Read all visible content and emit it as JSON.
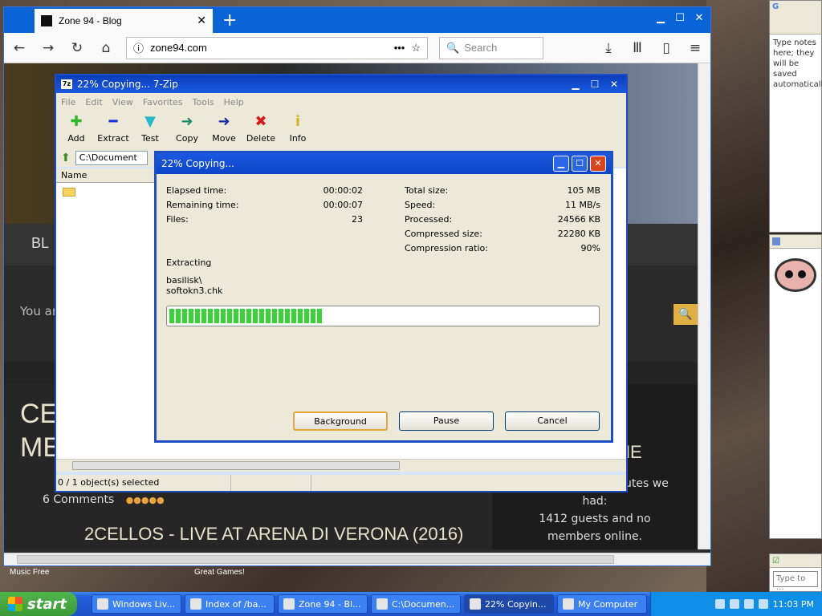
{
  "firefox": {
    "tab_title": "Zone 94 - Blog",
    "url": "zone94.com",
    "search_placeholder": "Search",
    "blog": {
      "nav_text": "BL",
      "breadcrumb": "You ar",
      "big_title": "CEL MET",
      "comments": "6 Comments",
      "post_title": "2CELLOS - LIVE AT ARENA DI VERONA (2016)",
      "side_heading": "INE",
      "side_minutes": "nutes we",
      "side_had": "had:",
      "side_guests": "1412 guests and no",
      "side_members": "members online."
    }
  },
  "zip": {
    "title": "22% Copying... 7-Zip",
    "menu": [
      "File",
      "Edit",
      "View",
      "Favorites",
      "Tools",
      "Help"
    ],
    "tools": [
      {
        "label": "Add",
        "glyph": "✚",
        "color": "#2fb82f",
        "name": "add"
      },
      {
        "label": "Extract",
        "glyph": "━",
        "color": "#1a2fd0",
        "name": "extract"
      },
      {
        "label": "Test",
        "glyph": "▼",
        "color": "#28b8c8",
        "name": "test"
      },
      {
        "label": "Copy",
        "glyph": "➜",
        "color": "#1c8c6c",
        "name": "copy"
      },
      {
        "label": "Move",
        "glyph": "➜",
        "color": "#1a2a9c",
        "name": "move"
      },
      {
        "label": "Delete",
        "glyph": "✖",
        "color": "#d41a1a",
        "name": "delete"
      },
      {
        "label": "Info",
        "glyph": "i",
        "color": "#d8b020",
        "name": "info"
      }
    ],
    "path": "C:\\Document",
    "column_name": "Name",
    "status": "0 / 1 object(s) selected"
  },
  "dialog": {
    "title": "22% Copying...",
    "left": [
      {
        "label": "Elapsed time:",
        "value": "00:00:02"
      },
      {
        "label": "Remaining time:",
        "value": "00:00:07"
      },
      {
        "label": "Files:",
        "value": "23"
      }
    ],
    "right": [
      {
        "label": "Total size:",
        "value": "105 MB"
      },
      {
        "label": "Speed:",
        "value": "11 MB/s"
      },
      {
        "label": "Processed:",
        "value": "24566 KB"
      },
      {
        "label": "Compressed size:",
        "value": "22280 KB"
      },
      {
        "label": "Compression ratio:",
        "value": "90%"
      }
    ],
    "action": "Extracting",
    "path_line1": "basilisk\\",
    "path_line2": "softokn3.chk",
    "progress_fraction": 0.36,
    "buttons": {
      "background": "Background",
      "pause": "Pause",
      "cancel": "Cancel"
    }
  },
  "gadgets": {
    "notes_text": "Type notes here; they will be saved automatically.",
    "type_to": "Type to ..."
  },
  "desktop": {
    "label1": "Music Free",
    "label2": "Great Games!"
  },
  "taskbar": {
    "start": "start",
    "tasks": [
      {
        "label": "Windows Liv...",
        "active": false
      },
      {
        "label": "Index of /ba...",
        "active": false
      },
      {
        "label": "Zone 94 - Bl...",
        "active": false
      },
      {
        "label": "C:\\Documen...",
        "active": false
      },
      {
        "label": "22% Copyin...",
        "active": true
      },
      {
        "label": "My Computer",
        "active": false
      }
    ],
    "clock": "11:03 PM"
  }
}
